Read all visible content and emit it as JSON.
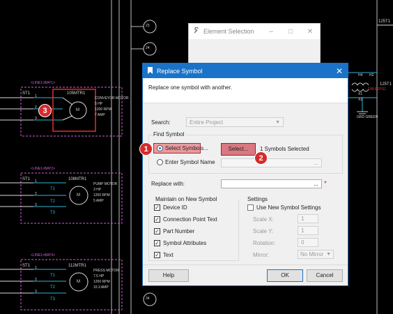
{
  "colors": {
    "background": "#000000",
    "dialog_title": "#1a73c8",
    "callout": "#d62b2b",
    "wire_cyan": "#2fb8d8",
    "frame_magenta": "#d060d8"
  },
  "background": {
    "line_numbers": [
      "23",
      "24",
      "34"
    ],
    "top_tag": "125T1",
    "rung1": {
      "label": "<LINE1>BAY1>",
      "st": "ST1",
      "terms": [
        "1",
        "2",
        "3"
      ],
      "tag": "105MTR1",
      "motor_glyph": "M",
      "desc": [
        "CONVEYOR MOTOR",
        "5 HP",
        "1200 RPM",
        "7 AMP"
      ]
    },
    "rung2": {
      "label": "<LINE1>BAY2>",
      "st": "ST1",
      "terms": [
        "1",
        "2",
        "3"
      ],
      "wires": [
        "T1",
        "T2",
        "T3"
      ],
      "tag": "108MTR1",
      "motor_glyph": "M",
      "desc": [
        "PUMP MOTOR",
        "3 HP",
        "1200 RPM",
        "5 AMP"
      ]
    },
    "rung3": {
      "label": "<LINE1>BAY3>",
      "st": "ST1",
      "terms": [
        "1",
        "2",
        "3"
      ],
      "wires": [
        "T1",
        "T2",
        "T3"
      ],
      "tag": "112MTR1",
      "motor_glyph": "M",
      "desc": [
        "PRESS MOTOR",
        "7.5 HP",
        "1200 RPM",
        "10.3 AMP"
      ]
    },
    "right_labels": {
      "h4": "H4",
      "x1": "X1",
      "x2": "X2",
      "tag_red": "108-E1PG1",
      "grd": "GRD GREEN",
      "t1": "125T1",
      "h_small": "H2"
    }
  },
  "element_selection": {
    "title": "Element Selection",
    "icon": "wrench-icon"
  },
  "dialog": {
    "title": "Replace Symbol",
    "icon": "bookmark-icon",
    "description": "Replace one symbol with another.",
    "search_label": "Search:",
    "search_value": "Entire Project",
    "find_symbol_title": "Find Symbol",
    "radio_select_label": "Select Symbols...",
    "radio_enter_label": "Enter Symbol Name",
    "select_button": "Select...",
    "selected_status": "1 Symbols Selected",
    "symbol_name_browse": "...",
    "replace_with_label": "Replace with:",
    "replace_browse": "...",
    "required_mark": "*",
    "maintain_title": "Maintain on New Symbol",
    "maintain_items": [
      {
        "label": "Device ID",
        "checked": true
      },
      {
        "label": "Connection Point Text",
        "checked": true
      },
      {
        "label": "Part Number",
        "checked": true
      },
      {
        "label": "Symbol Attributes",
        "checked": true
      },
      {
        "label": "Text",
        "checked": true
      }
    ],
    "settings_title": "Settings",
    "use_new_settings_label": "Use New Symbol Settings",
    "scale_x_label": "Scale X:",
    "scale_x_value": "1",
    "scale_y_label": "Scale Y:",
    "scale_y_value": "1",
    "rotation_label": "Rotation:",
    "rotation_value": "0",
    "mirror_label": "Mirror:",
    "mirror_value": "No Mirror",
    "help_button": "Help",
    "ok_button": "OK",
    "cancel_button": "Cancel"
  },
  "callouts": [
    "1",
    "2",
    "3"
  ]
}
